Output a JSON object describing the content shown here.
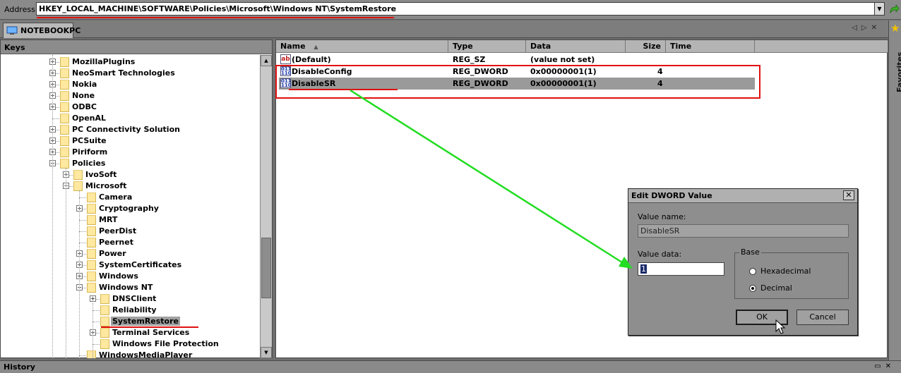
{
  "address": {
    "label": "Address",
    "value": "HKEY_LOCAL_MACHINE\\SOFTWARE\\Policies\\Microsoft\\Windows NT\\SystemRestore"
  },
  "tab": {
    "label": "NOTEBOOKPC",
    "icon": "computer-icon"
  },
  "favorites": {
    "label": "Favorites",
    "icon": "star-icon"
  },
  "keys_pane": {
    "title": "Keys",
    "items": [
      {
        "label": "MozillaPlugins",
        "level": 0,
        "expander": "+"
      },
      {
        "label": "NeoSmart Technologies",
        "level": 0,
        "expander": "+"
      },
      {
        "label": "Nokia",
        "level": 0,
        "expander": "+"
      },
      {
        "label": "None",
        "level": 0,
        "expander": "+"
      },
      {
        "label": "ODBC",
        "level": 0,
        "expander": "+"
      },
      {
        "label": "OpenAL",
        "level": 0,
        "expander": ""
      },
      {
        "label": "PC Connectivity Solution",
        "level": 0,
        "expander": "+"
      },
      {
        "label": "PCSuite",
        "level": 0,
        "expander": "+"
      },
      {
        "label": "Piriform",
        "level": 0,
        "expander": "+"
      },
      {
        "label": "Policies",
        "level": 0,
        "expander": "-"
      },
      {
        "label": "IvoSoft",
        "level": 1,
        "expander": "+"
      },
      {
        "label": "Microsoft",
        "level": 1,
        "expander": "-"
      },
      {
        "label": "Camera",
        "level": 2,
        "expander": ""
      },
      {
        "label": "Cryptography",
        "level": 2,
        "expander": "+"
      },
      {
        "label": "MRT",
        "level": 2,
        "expander": ""
      },
      {
        "label": "PeerDist",
        "level": 2,
        "expander": ""
      },
      {
        "label": "Peernet",
        "level": 2,
        "expander": ""
      },
      {
        "label": "Power",
        "level": 2,
        "expander": "+"
      },
      {
        "label": "SystemCertificates",
        "level": 2,
        "expander": "+"
      },
      {
        "label": "Windows",
        "level": 2,
        "expander": "+"
      },
      {
        "label": "Windows NT",
        "level": 2,
        "expander": "-"
      },
      {
        "label": "DNSClient",
        "level": 3,
        "expander": "+"
      },
      {
        "label": "Reliability",
        "level": 3,
        "expander": ""
      },
      {
        "label": "SystemRestore",
        "level": 3,
        "expander": "",
        "selected": true
      },
      {
        "label": "Terminal Services",
        "level": 3,
        "expander": "+"
      },
      {
        "label": "Windows File Protection",
        "level": 3,
        "expander": ""
      },
      {
        "label": "WindowsMediaPlayer",
        "level": 2,
        "expander": ""
      }
    ]
  },
  "values_pane": {
    "columns": [
      "Name",
      "Type",
      "Data",
      "Size",
      "Time"
    ],
    "rows": [
      {
        "name": "(Default)",
        "type": "REG_SZ",
        "data": "(value not set)",
        "size": "",
        "time": "",
        "icon": "string-value-icon"
      },
      {
        "name": "DisableConfig",
        "type": "REG_DWORD",
        "data": "0x00000001(1)",
        "size": "4",
        "time": "",
        "icon": "dword-value-icon"
      },
      {
        "name": "DisableSR",
        "type": "REG_DWORD",
        "data": "0x00000001(1)",
        "size": "4",
        "time": "",
        "icon": "dword-value-icon",
        "selected": true
      }
    ]
  },
  "dialog": {
    "title": "Edit DWORD Value",
    "value_name_label": "Value name:",
    "value_name": "DisableSR",
    "value_data_label": "Value data:",
    "value_data": "1",
    "base_label": "Base",
    "base_options": [
      "Hexadecimal",
      "Decimal"
    ],
    "base_selected": "Decimal",
    "ok_label": "OK",
    "cancel_label": "Cancel"
  },
  "history": {
    "label": "History"
  },
  "colors": {
    "annotation_red": "#e01010",
    "annotation_green": "#22dd22"
  }
}
